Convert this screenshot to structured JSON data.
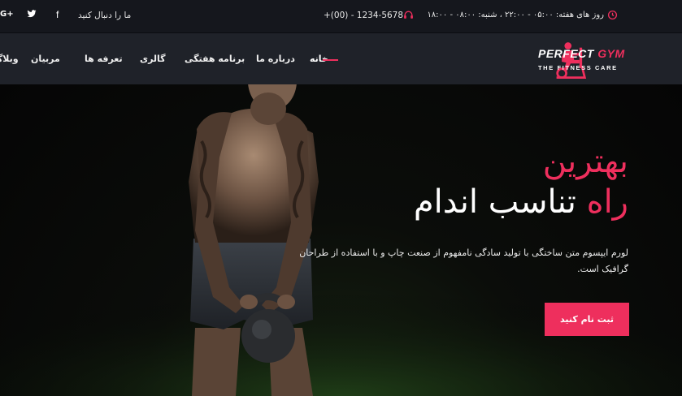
{
  "topbar": {
    "social_gplus": "G+",
    "social_facebook": "f",
    "follow_label": "ما را دنبال کنید",
    "phone": "+(00) - 1234-5678",
    "hours": "روز های هفته: ۰۵:۰۰ - ۲۲:۰۰ ، شنبه: ۰۸:۰۰ - ۱۸:۰۰",
    "icons": [
      "google-plus-icon",
      "twitter-icon",
      "facebook-icon",
      "headset-icon",
      "clock-icon"
    ]
  },
  "brand": {
    "name_part1": "PERFECT ",
    "name_part2": "GYM",
    "tagline": "THE FITNESS CARE",
    "accent_color": "#ee2f5d"
  },
  "nav": {
    "items": [
      {
        "label": "خانه",
        "active": true
      },
      {
        "label": "درباره ما"
      },
      {
        "label": "برنامه هفتگی"
      },
      {
        "label": "گالری"
      },
      {
        "label": "تعرفه ها"
      },
      {
        "label": "مربیان"
      },
      {
        "label": "وبلاگ"
      }
    ]
  },
  "hero": {
    "headline_line1": "بهترین",
    "headline_line2_pink": "راه",
    "headline_line2_white": "تناسب اندام",
    "description": "لورم ایپسوم متن ساختگی با تولید سادگی نامفهوم از صنعت چاپ و با استفاده از طراحان گرافیک است.",
    "cta_label": "ثبت نام کنید"
  }
}
